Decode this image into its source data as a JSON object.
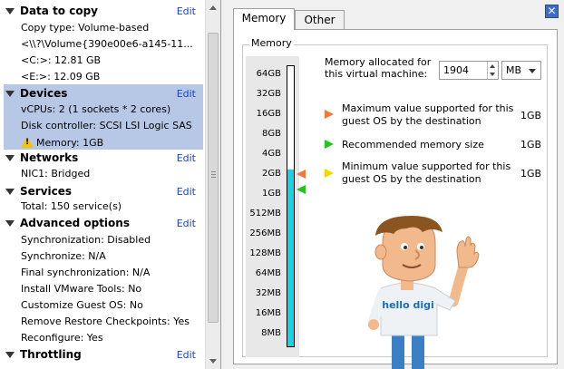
{
  "left_panel": {
    "sections": [
      {
        "title": "Data to copy",
        "edit": "Edit",
        "rows": [
          "Copy type: Volume-based",
          "<\\\\?\\Volume{390e00e6-a145-11...",
          "<C:>: 12.81 GB",
          "<E:>: 12.09 GB"
        ]
      },
      {
        "title": "Devices",
        "edit": "Edit",
        "rows": [
          "vCPUs: 2 (1 sockets * 2 cores)",
          "Disk controller: SCSI LSI Logic SAS",
          "Memory: 1GB"
        ]
      },
      {
        "title": "Networks",
        "edit": "Edit",
        "rows": [
          "NIC1: Bridged"
        ]
      },
      {
        "title": "Services",
        "edit": "Edit",
        "rows": [
          "Total: 150 service(s)"
        ]
      },
      {
        "title": "Advanced options",
        "edit": "Edit",
        "rows": [
          "Synchronization: Disabled",
          "Synchronize: N/A",
          "Final synchronization: N/A",
          "Install VMware Tools: No",
          "Customize Guest OS: No",
          "Remove Restore Checkpoints: Yes",
          "Reconfigure: Yes"
        ]
      },
      {
        "title": "Throttling",
        "edit": "Edit",
        "rows": []
      }
    ]
  },
  "tabs": [
    {
      "label": "Memory"
    },
    {
      "label": "Other"
    }
  ],
  "memory_group": {
    "title": "Memory",
    "scale_labels": [
      "64GB",
      "32GB",
      "16GB",
      "8GB",
      "4GB",
      "2GB",
      "1GB",
      "512MB",
      "256MB",
      "128MB",
      "64MB",
      "32MB",
      "16MB",
      "8MB"
    ],
    "allocated_label": "Memory allocated for this virtual machine:",
    "allocated_value": "1904",
    "allocated_unit": "MB",
    "fill_level_label": "2GB",
    "legend": [
      {
        "text": "Maximum value supported for this guest OS by the destination",
        "value": "1GB",
        "color": "#f07838"
      },
      {
        "text": "Recommended memory size",
        "value": "1GB",
        "color": "#22c422"
      },
      {
        "text": "Minimum value supported for this guest OS by the destination",
        "value": "1GB",
        "color": "#f0d800"
      }
    ]
  },
  "mascot": {
    "shirt_text": "hello digi"
  },
  "colors": {
    "accent": "#1a45c6",
    "highlight": "#b6c8e6",
    "bar_fill": "#16d3e6"
  }
}
